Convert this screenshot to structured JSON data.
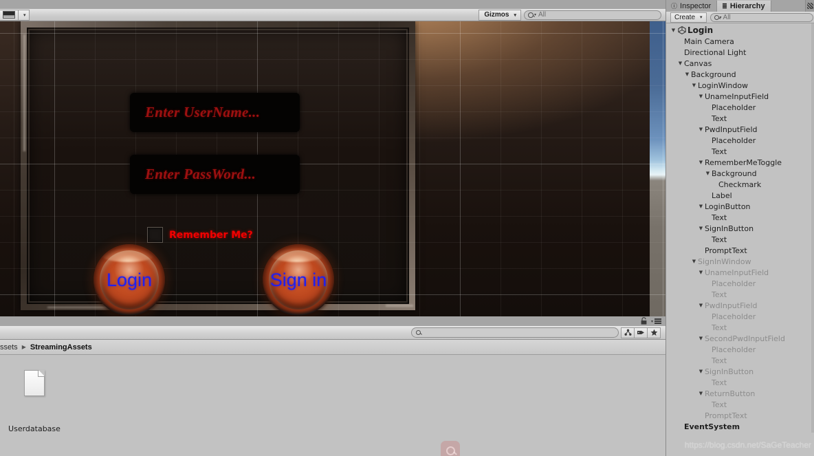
{
  "app": {
    "name": "Unity Editor"
  },
  "scene_toolbar": {
    "aspect_icon": "aspect-ratio-icon",
    "aspect_caret": "▾",
    "gizmos_label": "Gizmos",
    "gizmos_caret": "▾",
    "search_placeholder": "All",
    "search_value": "",
    "search_icon": "search-icon",
    "search_caret": "▾"
  },
  "game_view": {
    "login_panel": {
      "username_field": {
        "placeholder": "Enter UserName...",
        "value": ""
      },
      "password_field": {
        "placeholder": "Enter PassWord...",
        "value": ""
      },
      "remember_toggle": {
        "label": "Remember Me?",
        "checked": false
      },
      "login_button": {
        "label": "Login"
      },
      "signin_button": {
        "label": "Sign in"
      }
    },
    "colors": {
      "placeholder_red": "#9d1010",
      "label_red": "#f20000",
      "button_text_blue": "#2020ef",
      "button_orange": "#d35a28",
      "panel_dark": "#14100d"
    }
  },
  "project_panel": {
    "lock_icon": "lock-icon",
    "menu_icon": "panel-menu-icon",
    "search_placeholder": "",
    "search_value": "",
    "search_icon": "search-icon",
    "filters": [
      {
        "icon": "asset-type-filter-icon",
        "glyph": "▲"
      },
      {
        "icon": "label-filter-icon",
        "glyph": "⚑"
      },
      {
        "icon": "favorite-filter-icon",
        "glyph": "★"
      }
    ],
    "breadcrumb": [
      {
        "label": "ssets",
        "current": false
      },
      {
        "label": "StreamingAssets",
        "current": true
      }
    ],
    "breadcrumb_separator": "▶",
    "assets": [
      {
        "name": "Userdatabase",
        "icon": "file-icon"
      }
    ]
  },
  "right_panel": {
    "tabs": [
      {
        "label": "Inspector",
        "icon": "info-icon",
        "glyph": "ⓘ",
        "active": false
      },
      {
        "label": "Hierarchy",
        "icon": "hierarchy-icon",
        "glyph": "≣",
        "active": true
      }
    ],
    "partial_tab_icon": "scene-tab-icon",
    "menu_dots": "≡",
    "toolbar": {
      "create_label": "Create",
      "create_caret": "▾",
      "search_placeholder": "All",
      "search_value": "",
      "search_icon": "search-icon",
      "search_caret": "▾"
    },
    "tree": [
      {
        "label": "Login",
        "depth": 0,
        "arrow": "▼",
        "unity_icon": true,
        "bold": true,
        "inactive": false
      },
      {
        "label": "Main Camera",
        "depth": 1,
        "arrow": "",
        "unity_icon": false,
        "bold": false,
        "inactive": false
      },
      {
        "label": "Directional Light",
        "depth": 1,
        "arrow": "",
        "unity_icon": false,
        "bold": false,
        "inactive": false
      },
      {
        "label": "Canvas",
        "depth": 1,
        "arrow": "▼",
        "unity_icon": false,
        "bold": false,
        "inactive": false
      },
      {
        "label": "Background",
        "depth": 2,
        "arrow": "▼",
        "unity_icon": false,
        "bold": false,
        "inactive": false
      },
      {
        "label": "LoginWindow",
        "depth": 3,
        "arrow": "▼",
        "unity_icon": false,
        "bold": false,
        "inactive": false
      },
      {
        "label": "UnameInputField",
        "depth": 4,
        "arrow": "▼",
        "unity_icon": false,
        "bold": false,
        "inactive": false
      },
      {
        "label": "Placeholder",
        "depth": 5,
        "arrow": "",
        "unity_icon": false,
        "bold": false,
        "inactive": false
      },
      {
        "label": "Text",
        "depth": 5,
        "arrow": "",
        "unity_icon": false,
        "bold": false,
        "inactive": false
      },
      {
        "label": "PwdInputField",
        "depth": 4,
        "arrow": "▼",
        "unity_icon": false,
        "bold": false,
        "inactive": false
      },
      {
        "label": "Placeholder",
        "depth": 5,
        "arrow": "",
        "unity_icon": false,
        "bold": false,
        "inactive": false
      },
      {
        "label": "Text",
        "depth": 5,
        "arrow": "",
        "unity_icon": false,
        "bold": false,
        "inactive": false
      },
      {
        "label": "RememberMeToggle",
        "depth": 4,
        "arrow": "▼",
        "unity_icon": false,
        "bold": false,
        "inactive": false
      },
      {
        "label": "Background",
        "depth": 5,
        "arrow": "▼",
        "unity_icon": false,
        "bold": false,
        "inactive": false
      },
      {
        "label": "Checkmark",
        "depth": 6,
        "arrow": "",
        "unity_icon": false,
        "bold": false,
        "inactive": false
      },
      {
        "label": "Label",
        "depth": 5,
        "arrow": "",
        "unity_icon": false,
        "bold": false,
        "inactive": false
      },
      {
        "label": "LoginButton",
        "depth": 4,
        "arrow": "▼",
        "unity_icon": false,
        "bold": false,
        "inactive": false
      },
      {
        "label": "Text",
        "depth": 5,
        "arrow": "",
        "unity_icon": false,
        "bold": false,
        "inactive": false
      },
      {
        "label": "SignInButton",
        "depth": 4,
        "arrow": "▼",
        "unity_icon": false,
        "bold": false,
        "inactive": false
      },
      {
        "label": "Text",
        "depth": 5,
        "arrow": "",
        "unity_icon": false,
        "bold": false,
        "inactive": false
      },
      {
        "label": "PromptText",
        "depth": 4,
        "arrow": "",
        "unity_icon": false,
        "bold": false,
        "inactive": false
      },
      {
        "label": "SignInWindow",
        "depth": 3,
        "arrow": "▼",
        "unity_icon": false,
        "bold": false,
        "inactive": true
      },
      {
        "label": "UnameInputField",
        "depth": 4,
        "arrow": "▼",
        "unity_icon": false,
        "bold": false,
        "inactive": true
      },
      {
        "label": "Placeholder",
        "depth": 5,
        "arrow": "",
        "unity_icon": false,
        "bold": false,
        "inactive": true
      },
      {
        "label": "Text",
        "depth": 5,
        "arrow": "",
        "unity_icon": false,
        "bold": false,
        "inactive": true
      },
      {
        "label": "PwdInputField",
        "depth": 4,
        "arrow": "▼",
        "unity_icon": false,
        "bold": false,
        "inactive": true
      },
      {
        "label": "Placeholder",
        "depth": 5,
        "arrow": "",
        "unity_icon": false,
        "bold": false,
        "inactive": true
      },
      {
        "label": "Text",
        "depth": 5,
        "arrow": "",
        "unity_icon": false,
        "bold": false,
        "inactive": true
      },
      {
        "label": "SecondPwdInputField",
        "depth": 4,
        "arrow": "▼",
        "unity_icon": false,
        "bold": false,
        "inactive": true
      },
      {
        "label": "Placeholder",
        "depth": 5,
        "arrow": "",
        "unity_icon": false,
        "bold": false,
        "inactive": true
      },
      {
        "label": "Text",
        "depth": 5,
        "arrow": "",
        "unity_icon": false,
        "bold": false,
        "inactive": true
      },
      {
        "label": "SignInButton",
        "depth": 4,
        "arrow": "▼",
        "unity_icon": false,
        "bold": false,
        "inactive": true
      },
      {
        "label": "Text",
        "depth": 5,
        "arrow": "",
        "unity_icon": false,
        "bold": false,
        "inactive": true
      },
      {
        "label": "ReturnButton",
        "depth": 4,
        "arrow": "▼",
        "unity_icon": false,
        "bold": false,
        "inactive": true
      },
      {
        "label": "Text",
        "depth": 5,
        "arrow": "",
        "unity_icon": false,
        "bold": false,
        "inactive": true
      },
      {
        "label": "PromptText",
        "depth": 4,
        "arrow": "",
        "unity_icon": false,
        "bold": false,
        "inactive": true
      },
      {
        "label": "EventSystem",
        "depth": 1,
        "arrow": "",
        "unity_icon": false,
        "bold": true,
        "inactive": false
      }
    ]
  },
  "watermark": {
    "text": "https://blog.csdn.net/SaGeTeacher",
    "icon": "csdn-watermark-icon"
  }
}
